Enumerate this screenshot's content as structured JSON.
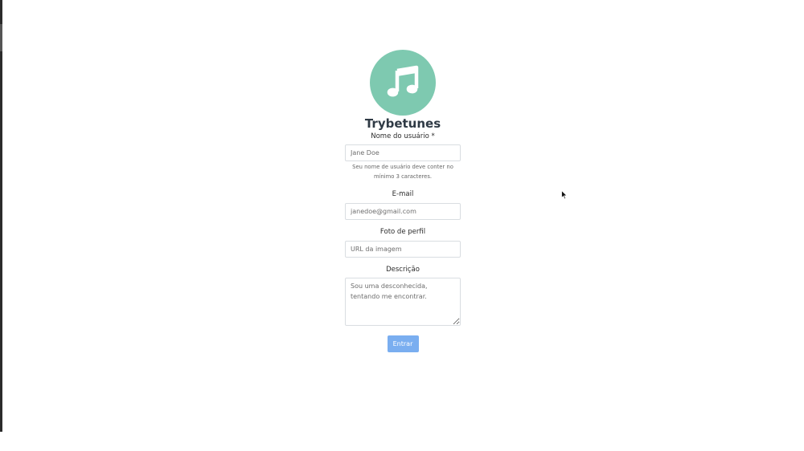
{
  "app": {
    "title": "Trybetunes",
    "logo_icon": "music-note-icon",
    "logo_color": "#7ec9b0"
  },
  "form": {
    "username": {
      "label": "Nome do usuário *",
      "placeholder": "Jane Doe",
      "help": "Seu nome de usuário deve conter no mínimo 3 caracteres."
    },
    "email": {
      "label": "E-mail",
      "placeholder": "janedoe@gmail.com"
    },
    "photo": {
      "label": "Foto de perfil",
      "placeholder": "URL da imagem"
    },
    "description": {
      "label": "Descrição",
      "placeholder": "Sou uma desconhecida, tentando me encontrar."
    },
    "submit": {
      "label": "Entrar",
      "color": "#7aaef0"
    }
  }
}
